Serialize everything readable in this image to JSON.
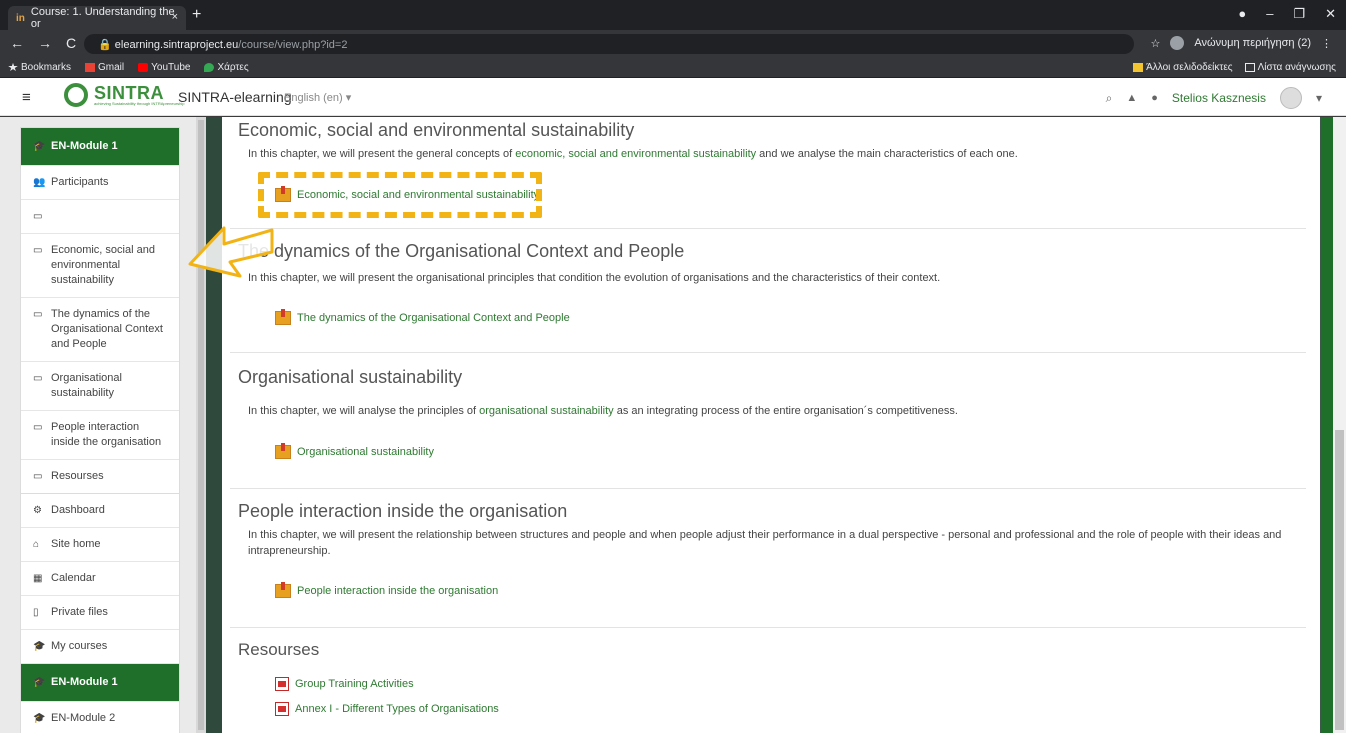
{
  "browser": {
    "tab_title": "Course: 1. Understanding the or",
    "tab_favicon": "in",
    "tab_close": "×",
    "new_tab": "+",
    "window_controls": [
      "●",
      "–",
      "❐",
      "✕"
    ],
    "nav_buttons": [
      "←",
      "→",
      "C"
    ],
    "url_host": "elearning.sintraproject.eu",
    "url_path": "/course/view.php?id=2",
    "star": "☆",
    "profile_label": "Ανώνυμη περιήγηση (2)",
    "menu_dots": "⋮",
    "bookmarks_left": [
      "Bookmarks",
      "Gmail",
      "YouTube",
      "Χάρτες"
    ],
    "bookmarks_right": [
      "Άλλοι σελιδοδείκτες",
      "Λίστα ανάγνωσης"
    ]
  },
  "header": {
    "menu_icon": "≡",
    "logo_text": "SINTRA",
    "logo_subtext": "achieving Sustainability through INTRApreneurship",
    "site_name": "SINTRA-elearning",
    "language": "English (en) ▾",
    "search_icon": "⌕",
    "bell_icon": "🔔",
    "chat_icon": "💬",
    "user_name": "Stelios Kasznesis",
    "user_menu": "▾"
  },
  "sidebar": {
    "course_items": [
      {
        "label": "EN-Module 1",
        "icon": "🎓",
        "active": true
      },
      {
        "label": "Participants",
        "icon": "👥",
        "active": false
      },
      {
        "label": "",
        "icon": "▭",
        "active": false
      },
      {
        "label": "Economic, social and environmental sustainability",
        "icon": "▭",
        "active": false
      },
      {
        "label": "The dynamics of the Organisational Context and People",
        "icon": "▭",
        "active": false
      },
      {
        "label": "Organisational sustainability",
        "icon": "▭",
        "active": false
      },
      {
        "label": "People interaction inside the organisation",
        "icon": "▭",
        "active": false
      },
      {
        "label": "Resourses",
        "icon": "▭",
        "active": false
      }
    ],
    "site_items": [
      {
        "label": "Dashboard",
        "icon": "⚙",
        "active": false
      },
      {
        "label": "Site home",
        "icon": "⌂",
        "active": false
      },
      {
        "label": "Calendar",
        "icon": "▦",
        "active": false
      },
      {
        "label": "Private files",
        "icon": "▯",
        "active": false
      },
      {
        "label": "My courses",
        "icon": "🎓",
        "active": false
      },
      {
        "label": "EN-Module 1",
        "icon": "🎓",
        "active": true
      },
      {
        "label": "EN-Module 2",
        "icon": "🎓",
        "active": false
      }
    ]
  },
  "sections": [
    {
      "title": "Economic, social and environmental sustainability",
      "summary_pre": "In this chapter, we will present the general concepts of ",
      "summary_link": "economic, social and environmental sustainability",
      "summary_post": " and we analyse the main characteristics of each one.",
      "activity": "Economic, social and environmental sustainability"
    },
    {
      "title": "The dynamics of the Organisational Context and People",
      "summary": "In this chapter, we will present the organisational principles that condition the evolution of organisations and the characteristics of their context.",
      "activity": "The dynamics of the Organisational Context and People"
    },
    {
      "title": "Organisational sustainability",
      "summary_pre": "In this chapter, we will analyse the principles of ",
      "summary_link": "organisational sustainability",
      "summary_post": " as an integrating process of the entire organisation´s competitiveness.",
      "activity": "Organisational sustainability"
    },
    {
      "title": "People interaction inside the organisation",
      "summary": "In this chapter, we will present the relationship between structures and people and when people adjust their performance in a dual perspective - personal and professional and the role of people with their ideas and intrapreneurship.",
      "activity": "People interaction inside the organisation"
    },
    {
      "title": "Resourses",
      "resources": [
        "Group Training Activities",
        "Annex I - Different Types of Organisations"
      ]
    }
  ],
  "colors": {
    "brand_green": "#1f6f2a",
    "link_green": "#2f7a32",
    "highlight_yellow": "#f2b315"
  }
}
